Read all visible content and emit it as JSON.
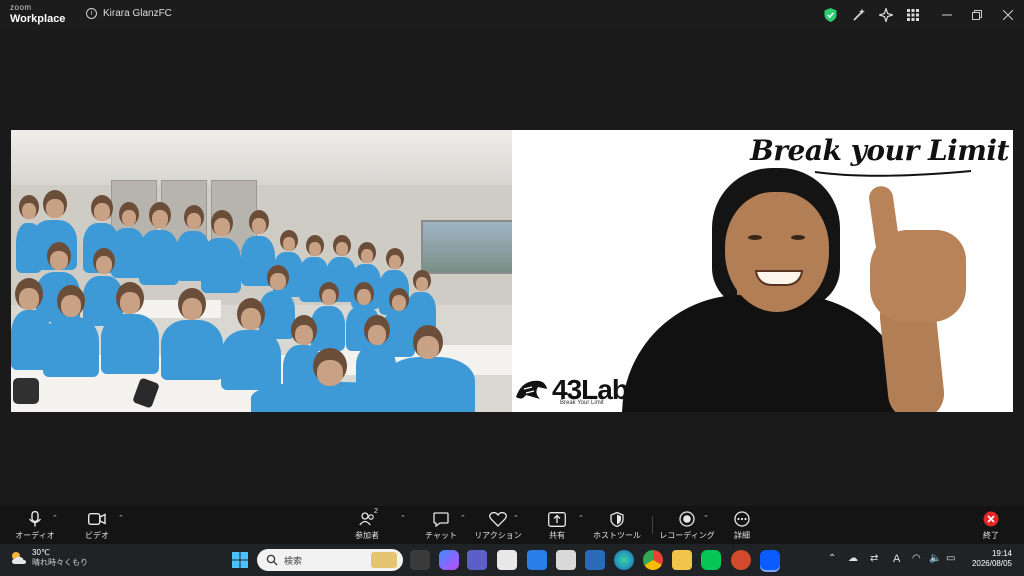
{
  "titlebar": {
    "brand_top": "zoom",
    "brand_bottom": "Workplace",
    "meeting_name": "Kirara GlanzFC",
    "icons": [
      "shield-check-icon",
      "magic-wand-icon",
      "ai-sparkle-icon",
      "apps-grid-icon"
    ],
    "window_controls": [
      "minimize-icon",
      "restore-icon",
      "close-icon"
    ]
  },
  "video": {
    "right_tile": {
      "slogan": "Break your Limit",
      "logo": "43Lab",
      "logo_subtitle": "Break Your Limit"
    }
  },
  "toolbar": {
    "audio": "オーディオ",
    "video": "ビデオ",
    "participants": "参加者",
    "participants_count": "2",
    "chat": "チャット",
    "reactions": "リアクション",
    "share": "共有",
    "host_tools": "ホストツール",
    "recording": "レコーディング",
    "more": "詳細",
    "end": "終了",
    "colors": {
      "end": "#e02828",
      "shield": "#2ecc71"
    }
  },
  "taskbar": {
    "weather_temp": "30℃",
    "weather_text": "晴れ時々くもり",
    "search_placeholder": "検索",
    "time": "19:14",
    "date": "2026/08/05",
    "ime": "A"
  }
}
